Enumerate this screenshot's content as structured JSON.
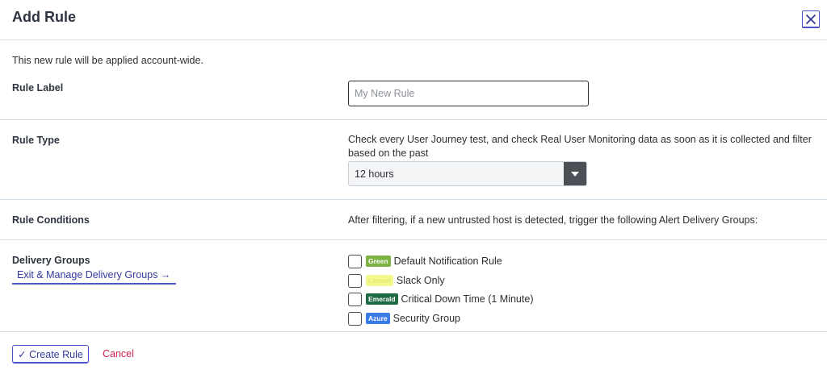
{
  "dialog": {
    "title": "Add Rule",
    "close_icon": "close-icon"
  },
  "intro_text": "This new rule will be applied account-wide.",
  "rule_label": {
    "label": "Rule Label",
    "placeholder": "My New Rule",
    "value": ""
  },
  "rule_type": {
    "label": "Rule Type",
    "description": "Check every User Journey test, and check Real User Monitoring data as soon as it is collected and filter based on the past",
    "selected": "12 hours",
    "arrow_icon": "caret-down-icon"
  },
  "rule_conditions": {
    "label": "Rule Conditions",
    "description": "After filtering, if a new untrusted host is detected, trigger the following Alert Delivery Groups:"
  },
  "delivery_groups": {
    "label": "Delivery Groups",
    "manage_link": "Exit & Manage Delivery Groups →",
    "items": [
      {
        "badge": "Green",
        "badge_bg": "#7cb342",
        "badge_fg": "#ffffff",
        "name": "Default Notification Rule"
      },
      {
        "badge": "Lemon",
        "badge_bg": "#f3f98e",
        "badge_fg": "#e3e86c",
        "name": "Slack Only"
      },
      {
        "badge": "Emerald",
        "badge_bg": "#1e6b43",
        "badge_fg": "#ffffff",
        "name": "Critical Down Time (1 Minute)"
      },
      {
        "badge": "Azure",
        "badge_bg": "#3b7be6",
        "badge_fg": "#ffffff",
        "name": "Security Group"
      }
    ]
  },
  "footer": {
    "create_label": "✓ Create Rule",
    "cancel_label": "Cancel"
  },
  "colors": {
    "accent": "#4a56c9",
    "link": "#333a9b",
    "danger": "#d3204f",
    "divider": "#d3e0ea"
  }
}
